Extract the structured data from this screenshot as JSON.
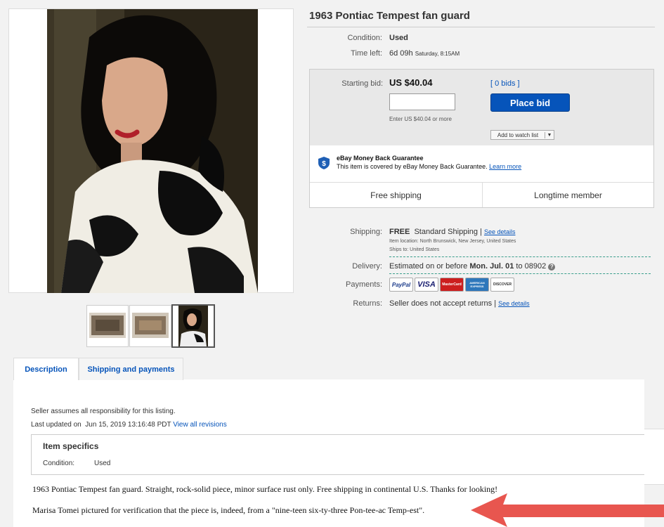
{
  "listing": {
    "title": "1963 Pontiac Tempest fan guard",
    "condition_label": "Condition:",
    "condition_value": "Used",
    "time_left_label": "Time left:",
    "time_left_value": "6d 09h",
    "time_left_detail": "Saturday, 8:15AM"
  },
  "bid": {
    "starting_bid_label": "Starting bid:",
    "starting_bid_value": "US $40.04",
    "bids_link": "[ 0 bids ]",
    "input_value": "",
    "hint": "Enter US $40.04 or more",
    "place_bid_label": "Place bid",
    "watch_label": "Add to watch list"
  },
  "guarantee": {
    "title": "eBay Money Back Guarantee",
    "text": "This item is covered by eBay Money Back Guarantee.",
    "link": "Learn more"
  },
  "highlights": {
    "shipping": "Free shipping",
    "member": "Longtime member"
  },
  "shipping": {
    "label": "Shipping:",
    "free": "FREE",
    "method": "Standard Shipping",
    "sep": "|",
    "details_link": "See details",
    "location": "Item location:  North Brunswick, New Jersey, United States",
    "ships_to": "Ships to:  United States"
  },
  "delivery": {
    "label": "Delivery:",
    "prefix": "Estimated on or before",
    "date": "Mon. Jul. 01",
    "suffix": "to 08902",
    "help_icon": "?"
  },
  "payments": {
    "label": "Payments:",
    "cards": [
      "PayPal",
      "VISA",
      "MasterCard",
      "AMERICAN EXPRESS",
      "DISCOVER"
    ]
  },
  "returns": {
    "label": "Returns:",
    "text": "Seller does not accept returns",
    "sep": "|",
    "link": "See details"
  },
  "tabs": {
    "description": "Description",
    "shipping_payments": "Shipping and payments"
  },
  "description": {
    "responsibility": "Seller assumes all responsibility for this listing.",
    "updated_label": "Last updated on",
    "updated_value": "Jun 15, 2019 13:16:48 PDT",
    "revisions_link": "View all revisions",
    "specifics_title": "Item specifics",
    "specifics_condition_label": "Condition:",
    "specifics_condition_value": "Used",
    "paragraph1": "1963 Pontiac Tempest fan guard. Straight, rock-solid piece, minor surface rust only. Free shipping in continental U.S. Thanks for looking!",
    "paragraph2": "Marisa Tomei pictured for verification that the piece is, indeed, from a \"nine-teen six-ty-three Pon-tee-ac Temp-est\"."
  },
  "colors": {
    "link": "#0654ba",
    "button": "#0654ba",
    "arrow": "#e8564f"
  }
}
